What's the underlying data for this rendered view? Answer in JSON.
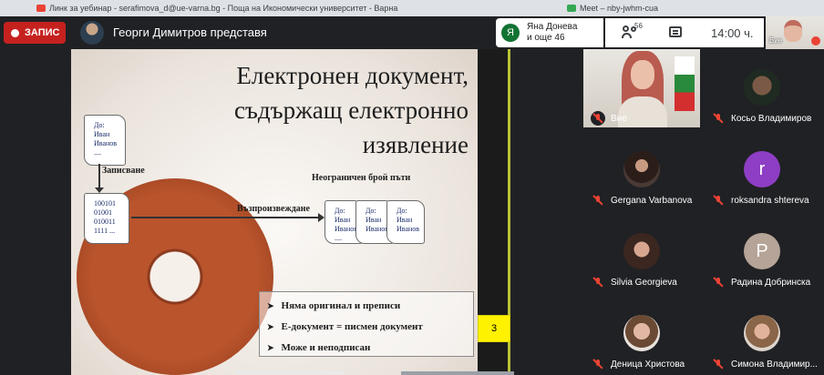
{
  "browser": {
    "tabs": [
      {
        "title": "Линк за уебинар - serafimova_d@ue-varna.bg - Поща на Икономически университет - Варна"
      },
      {
        "title": "Meet – nby-jwhm-cua"
      }
    ]
  },
  "topbar": {
    "record_label": "ЗАПИС",
    "presenter_text": "Георги Димитров представя",
    "attendees": {
      "avatar_letter": "Я",
      "line1": "Яна Донева",
      "line2": "и още 46"
    },
    "participants_count": "56",
    "time": "14:00 ч.",
    "self_label": "Вие"
  },
  "slide": {
    "title_lines": [
      "Електронен документ,",
      "съдържащ електронно",
      "изявление"
    ],
    "note_original": [
      "До:",
      "Иван",
      "Иванов",
      "...."
    ],
    "note_binary": [
      "100101",
      "01001",
      "010011",
      "1111 ..."
    ],
    "note_copy": [
      "До:",
      "Иван",
      "Иванов",
      "...."
    ],
    "label_record": "Записване",
    "label_reproduce": "Възпроизвеждане",
    "label_unlimited": "Неограничен брой пъти",
    "bullets": [
      "Няма оригинал и преписи",
      "Е-документ = писмен документ",
      "Може и неподписан"
    ],
    "page_number": "3"
  },
  "participants": [
    {
      "name": "Вие"
    },
    {
      "name": "Косьо Владимиров"
    },
    {
      "name": "Gergana Varbanova"
    },
    {
      "name": "roksandra shtereva",
      "letter": "r"
    },
    {
      "name": "Silvia Georgieva"
    },
    {
      "name": "Радина Добринска",
      "letter": "P"
    },
    {
      "name": "Деница Христова"
    },
    {
      "name": "Симона Владимир..."
    }
  ]
}
